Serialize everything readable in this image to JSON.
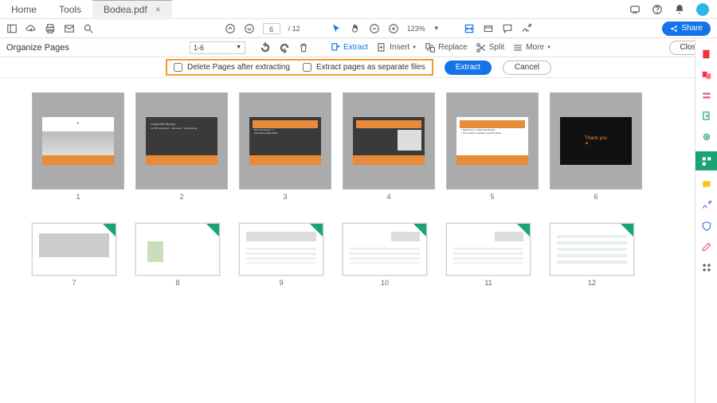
{
  "tabs": {
    "home": "Home",
    "tools": "Tools",
    "doc": "Bodea.pdf"
  },
  "toolbar": {
    "page_current": "6",
    "page_total": "/ 12",
    "zoom": "123%"
  },
  "share": {
    "label": "Share"
  },
  "orgbar": {
    "title": "Organize Pages",
    "range": "1-6",
    "extract": "Extract",
    "insert": "Insert",
    "replace": "Replace",
    "split": "Split",
    "more": "More",
    "close": "Close"
  },
  "subbar": {
    "delete_after": "Delete Pages after extracting",
    "separate_files": "Extract pages as separate files",
    "extract_btn": "Extract",
    "cancel_btn": "Cancel"
  },
  "pages": {
    "r1": [
      "1",
      "2",
      "3",
      "4",
      "5",
      "6"
    ],
    "r2": [
      "7",
      "8",
      "9",
      "10",
      "11",
      "12"
    ]
  }
}
